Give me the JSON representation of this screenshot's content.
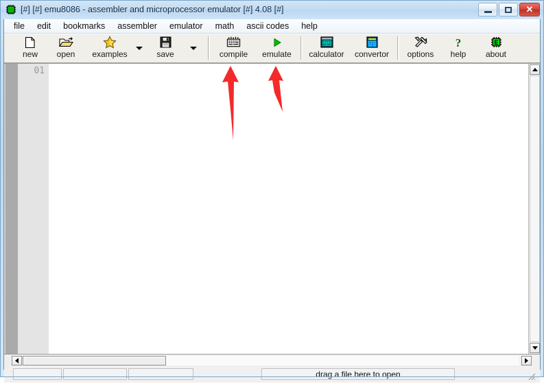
{
  "window": {
    "title": "[#] [#] emu8086 - assembler and microprocessor emulator [#] 4.08 [#]",
    "icon": "chip-icon",
    "controls": {
      "minimize": "minimize-button",
      "maximize": "maximize-button",
      "close_label": "✕"
    },
    "colors": {
      "title_gradient_top": "#d4e6f7",
      "title_gradient_bottom": "#cde4f8",
      "close_red": "#d4483c",
      "frame_blue": "#bcd8ee",
      "toolbar_face": "#f0efea",
      "gutter_dark": "#aaaaaa",
      "gutter_light": "#e4e4e4",
      "annotation_red": "#f42a2a"
    }
  },
  "menubar": {
    "items": [
      {
        "label": "file"
      },
      {
        "label": "edit"
      },
      {
        "label": "bookmarks"
      },
      {
        "label": "assembler"
      },
      {
        "label": "emulator"
      },
      {
        "label": "math"
      },
      {
        "label": "ascii codes"
      },
      {
        "label": "help"
      }
    ]
  },
  "toolbar": {
    "groups": [
      {
        "buttons": [
          {
            "label": "new",
            "icon": "new-file-icon",
            "dropdown": false
          },
          {
            "label": "open",
            "icon": "open-folder-icon",
            "dropdown": false
          },
          {
            "label": "examples",
            "icon": "star-icon",
            "dropdown": true
          },
          {
            "label": "save",
            "icon": "floppy-disk-icon",
            "dropdown": true
          }
        ]
      },
      {
        "buttons": [
          {
            "label": "compile",
            "icon": "compile-icon",
            "dropdown": false
          },
          {
            "label": "emulate",
            "icon": "play-icon",
            "dropdown": false
          }
        ]
      },
      {
        "buttons": [
          {
            "label": "calculator",
            "icon": "calculator-icon",
            "dropdown": false
          },
          {
            "label": "convertor",
            "icon": "convertor-icon",
            "dropdown": false
          }
        ]
      },
      {
        "buttons": [
          {
            "label": "options",
            "icon": "tools-icon",
            "dropdown": false
          },
          {
            "label": "help",
            "icon": "question-mark-icon",
            "dropdown": false
          },
          {
            "label": "about",
            "icon": "chip-e-icon",
            "dropdown": false
          }
        ]
      }
    ]
  },
  "editor": {
    "line_numbers": [
      "01"
    ],
    "content": "",
    "vertical_scrollbar": {
      "up": "scroll-up",
      "down": "scroll-down"
    },
    "horizontal_scrollbar": {
      "left": "scroll-left",
      "right": "scroll-right"
    }
  },
  "statusbar": {
    "panel1": "",
    "panel2": "",
    "panel3": "",
    "drag_hint": "drag a file here to open"
  },
  "annotations": [
    {
      "name": "arrow-to-compile",
      "points_to": "compile",
      "color": "#f42a2a"
    },
    {
      "name": "arrow-to-emulate",
      "points_to": "emulate",
      "color": "#f42a2a"
    }
  ]
}
